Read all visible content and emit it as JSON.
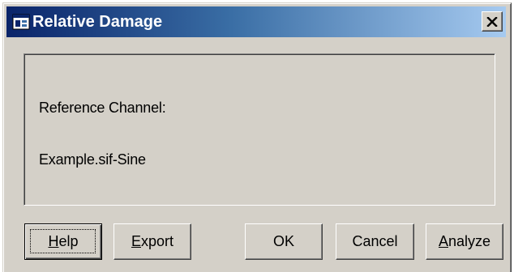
{
  "window": {
    "title": "Relative Damage",
    "icon": "app-window-icon"
  },
  "title_bar": {
    "close_glyph": "✕",
    "close_icon": "close-icon",
    "gradient": [
      "#0a246a",
      "#a6caf0"
    ]
  },
  "panel": {
    "reference_label": "Reference Channel:",
    "reference_value": "Example.sif-Sine"
  },
  "buttons": {
    "help": {
      "label": "Help",
      "mnemonic": "H",
      "rest": "elp"
    },
    "export": {
      "label": "Export",
      "mnemonic": "E",
      "rest": "xport"
    },
    "ok": {
      "label": "OK"
    },
    "cancel": {
      "label": "Cancel"
    },
    "analyze": {
      "label": "Analyze",
      "mnemonic": "A",
      "rest": "nalyze"
    }
  },
  "colors": {
    "dialog_face": "#d4d0c8",
    "title_start": "#0a246a",
    "title_end": "#a6caf0",
    "title_text": "#ffffff"
  }
}
